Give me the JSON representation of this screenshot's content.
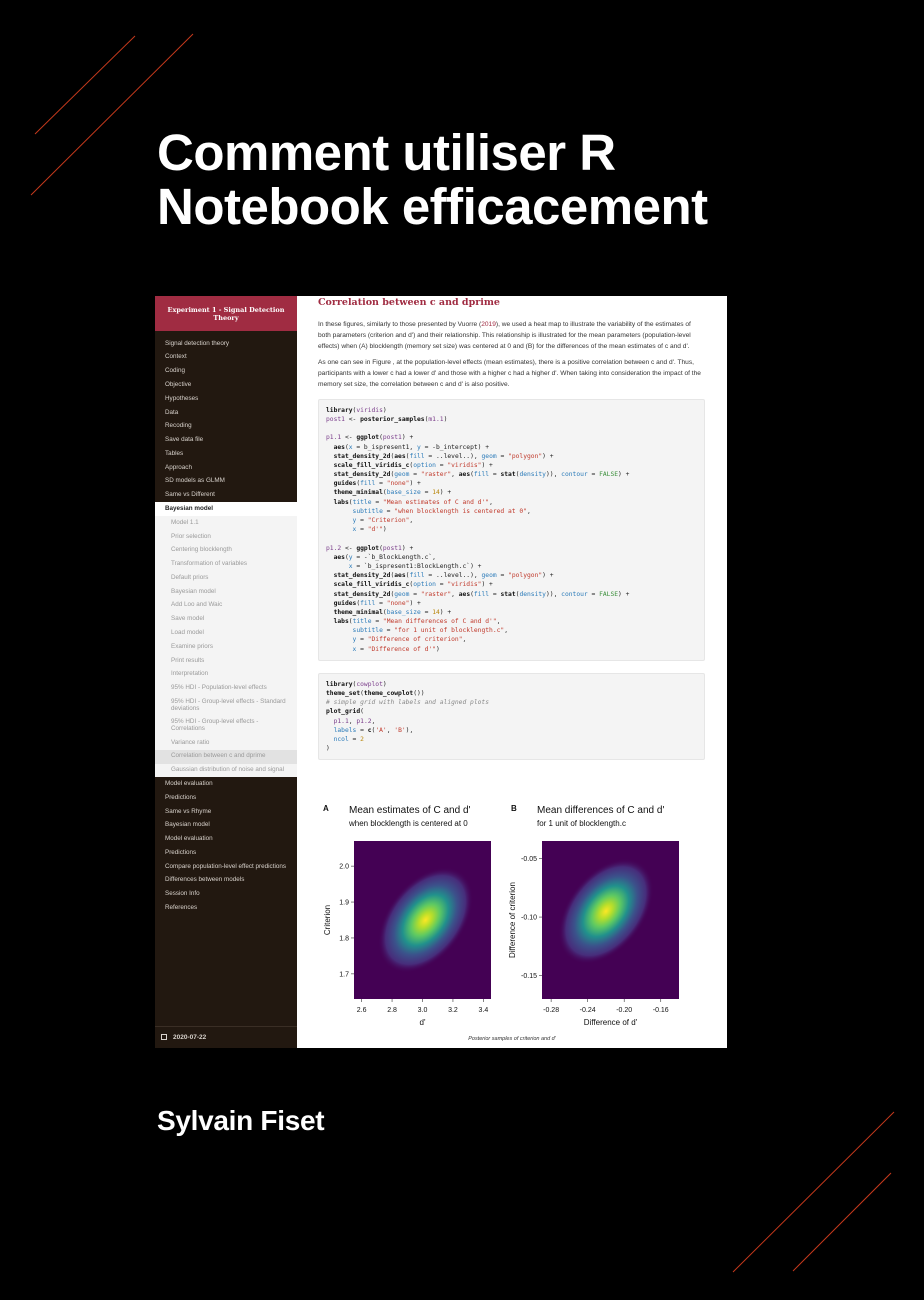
{
  "cover": {
    "title_line1": "Comment utiliser R",
    "title_line2": "Notebook efficacement",
    "author": "Sylvain Fiset",
    "accent_color": "#d13a1a"
  },
  "screenshot": {
    "sidebar": {
      "header": "Experiment 1 - Signal Detection Theory",
      "items": [
        "Signal detection theory",
        "Context",
        "Coding",
        "Objective",
        "Hypotheses",
        "Data",
        "Recoding",
        "Save data file",
        "Tables",
        "Approach",
        "SD models as GLMM",
        "Same vs Different"
      ],
      "active": "Bayesian model",
      "subitems": [
        "Model 1.1",
        "Prior selection",
        "Centering blocklength",
        "Transformation of variables",
        "Default priors",
        "Bayesian model",
        "Add Loo and Waic",
        "Save model",
        "Load model",
        "Examine priors",
        "Print results",
        "Interpretation",
        "95% HDI - Population-level effects",
        "95% HDI - Group-level effects - Standard deviations",
        "95% HDI - Group-level effects - Correlations",
        "Variance ratio"
      ],
      "subactive": "Correlation between c and dprime",
      "subafter": [
        "Gaussian distribution of noise and signal"
      ],
      "items_after": [
        "Model evaluation",
        "Predictions",
        "Same vs Rhyme",
        "Bayesian model",
        "Model evaluation",
        "Predictions",
        "Compare population-level effect predictions",
        "Differences between models",
        "Session Info",
        "References"
      ],
      "footer_date": "2020-07-22",
      "calendar_icon": "calendar-icon"
    },
    "main": {
      "section_title": "Correlation between c and dprime",
      "para1_a": "In these figures, similarly to those presented by Vuorre (",
      "para1_link": "2019",
      "para1_b": "), we used a heat map to illustrate the variability of the estimates of both parameters (criterion and d') and their relationship. This relationship is illustrated for the mean parameters (population-level effects) when (A) blocklength (memory set size) was centered at 0 and (B) for the differences of the mean estimates of c and d'.",
      "para2": "As one can see in Figure , at the population-level effects (mean estimates), there is a positive correlation between c and d'. Thus, participants with a lower c had a lower d' and those with a higher c had a higher d'. When taking into consideration the impact of the memory set size, the correlation between c and d' is also positive.",
      "caption": "Posterior samples of criterion and d'"
    }
  },
  "chart_data": [
    {
      "type": "heatmap",
      "panel": "A",
      "title": "Mean estimates of C and d'",
      "subtitle": "when blocklength is centered at 0",
      "xlabel": "d'",
      "ylabel": "Criterion",
      "xlim": [
        2.55,
        3.45
      ],
      "ylim": [
        1.63,
        2.07
      ],
      "xticks": [
        "2.6",
        "2.8",
        "3.0",
        "3.2",
        "3.4"
      ],
      "xtick_values": [
        2.6,
        2.8,
        3.0,
        3.2,
        3.4
      ],
      "yticks": [
        "1.7",
        "1.8",
        "1.9",
        "2.0"
      ],
      "ytick_values": [
        1.7,
        1.8,
        1.9,
        2.0
      ],
      "peak": {
        "x": 3.02,
        "y": 1.85
      },
      "correlation": "positive",
      "colormap": "viridis"
    },
    {
      "type": "heatmap",
      "panel": "B",
      "title": "Mean differences of C and d'",
      "subtitle": "for 1 unit of blocklength.c",
      "xlabel": "Difference of d'",
      "ylabel": "Difference of criterion",
      "xlim": [
        -0.29,
        -0.14
      ],
      "ylim": [
        -0.17,
        -0.035
      ],
      "xticks": [
        "-0.28",
        "-0.24",
        "-0.20",
        "-0.16"
      ],
      "xtick_values": [
        -0.28,
        -0.24,
        -0.2,
        -0.16
      ],
      "yticks": [
        "-0.15",
        "-0.10",
        "-0.05"
      ],
      "ytick_values": [
        -0.15,
        -0.1,
        -0.05
      ],
      "peak": {
        "x": -0.22,
        "y": -0.095
      },
      "correlation": "positive",
      "colormap": "viridis"
    }
  ]
}
